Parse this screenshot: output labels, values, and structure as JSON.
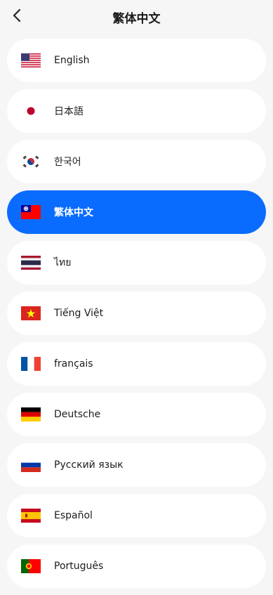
{
  "header": {
    "title": "繁体中文",
    "back_icon": "chevron-left-icon"
  },
  "languages": [
    {
      "label": "English",
      "flag": "us-flag-icon",
      "selected": false
    },
    {
      "label": "日本語",
      "flag": "japan-flag-icon",
      "selected": false
    },
    {
      "label": "한국어",
      "flag": "korea-flag-icon",
      "selected": false
    },
    {
      "label": "繁体中文",
      "flag": "taiwan-flag-icon",
      "selected": true
    },
    {
      "label": "ไทย",
      "flag": "thailand-flag-icon",
      "selected": false
    },
    {
      "label": "Tiếng Việt",
      "flag": "vietnam-flag-icon",
      "selected": false
    },
    {
      "label": "français",
      "flag": "france-flag-icon",
      "selected": false
    },
    {
      "label": "Deutsche",
      "flag": "germany-flag-icon",
      "selected": false
    },
    {
      "label": "Русский язык",
      "flag": "russia-flag-icon",
      "selected": false
    },
    {
      "label": "Español",
      "flag": "spain-flag-icon",
      "selected": false
    },
    {
      "label": "Português",
      "flag": "portugal-flag-icon",
      "selected": false
    }
  ],
  "colors": {
    "selected_background": "#0a6cff",
    "item_background": "#ffffff",
    "page_background": "#f6f6f6"
  }
}
